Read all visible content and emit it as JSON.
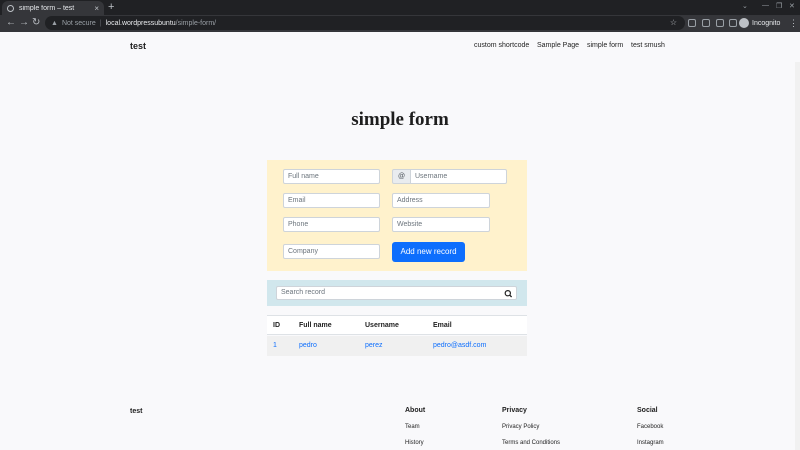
{
  "browser": {
    "tab_title": "simple form – test",
    "tab_close": "×",
    "new_tab": "+",
    "security_label": "Not secure",
    "url_host": "local.wordpressubuntu",
    "url_path": "/simple-form/",
    "profile_label": "Incognito"
  },
  "site": {
    "title": "test",
    "nav": [
      "custom shortcode",
      "Sample Page",
      "simple form",
      "test smush"
    ]
  },
  "page": {
    "title": "simple form"
  },
  "form": {
    "fullname_placeholder": "Full name",
    "at_symbol": "@",
    "username_placeholder": "Username",
    "email_placeholder": "Email",
    "address_placeholder": "Address",
    "phone_placeholder": "Phone",
    "website_placeholder": "Website",
    "company_placeholder": "Company",
    "submit_label": "Add new record"
  },
  "search": {
    "placeholder": "Search record"
  },
  "table": {
    "headers": [
      "ID",
      "Full name",
      "Username",
      "Email"
    ],
    "rows": [
      {
        "id": "1",
        "fullname": "pedro",
        "username": "perez",
        "email": "pedro@asdf.com"
      }
    ]
  },
  "footer": {
    "site_title": "test",
    "columns": [
      {
        "heading": "About",
        "links": [
          "Team",
          "History"
        ]
      },
      {
        "heading": "Privacy",
        "links": [
          "Privacy Policy",
          "Terms and Conditions"
        ]
      },
      {
        "heading": "Social",
        "links": [
          "Facebook",
          "Instagram"
        ]
      }
    ]
  },
  "colors": {
    "form_bg": "#fff2cc",
    "search_bg": "#d1e7ed",
    "primary": "#0d6efd"
  }
}
